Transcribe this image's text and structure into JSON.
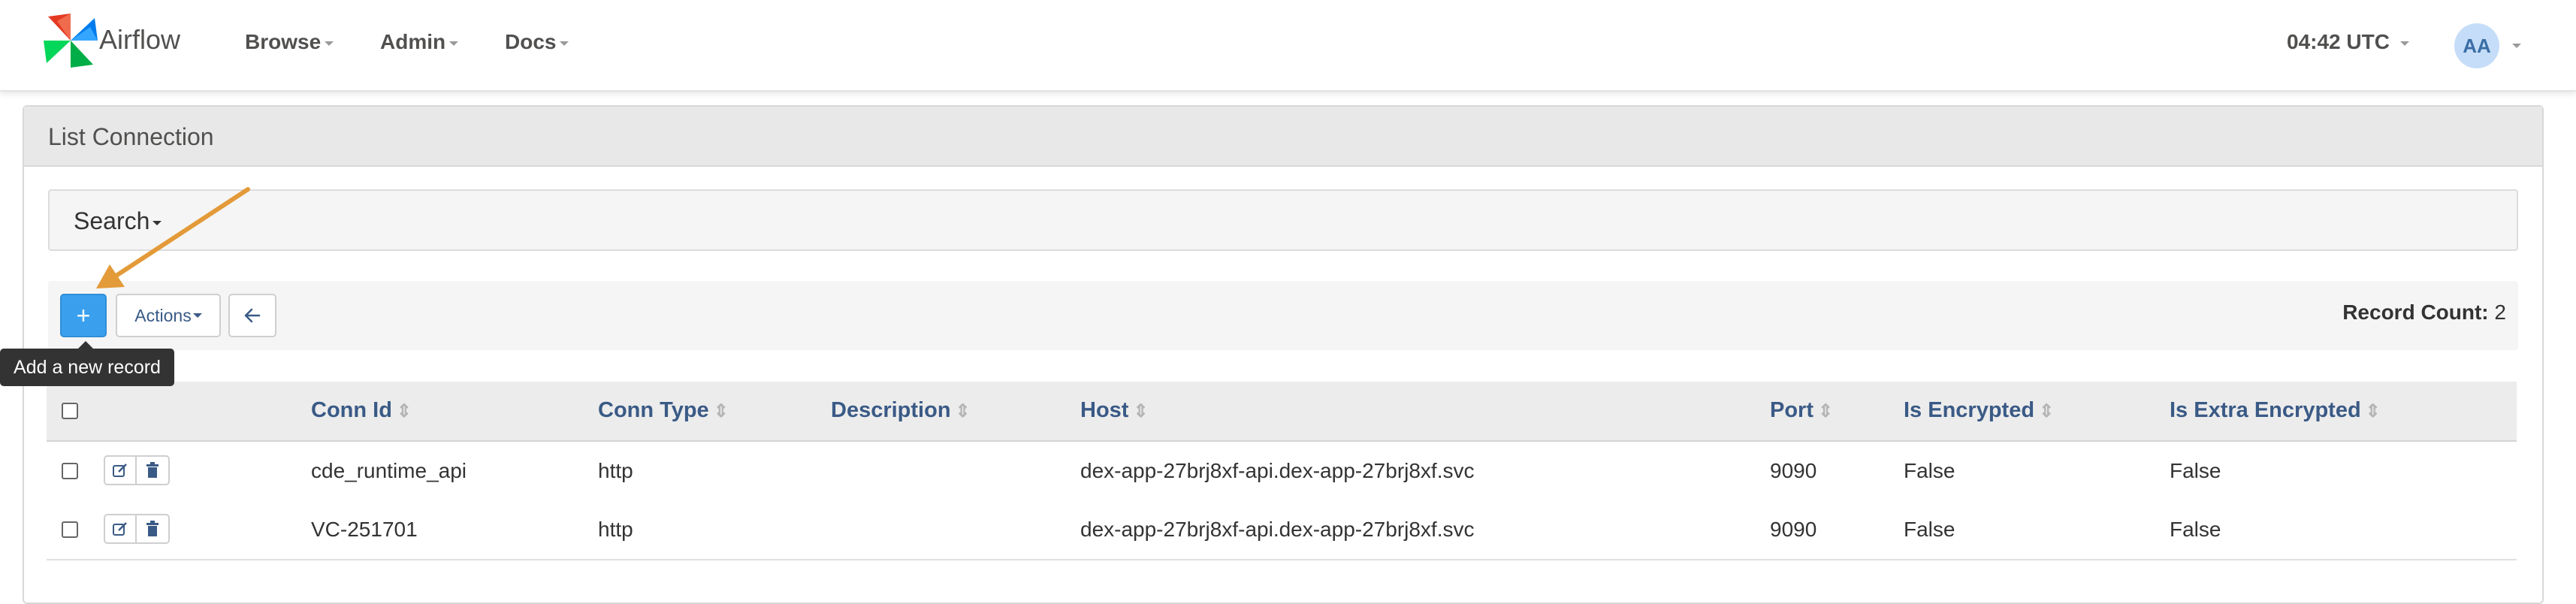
{
  "navbar": {
    "brand": "Airflow",
    "menu": [
      "Browse",
      "Admin",
      "Docs"
    ],
    "clock": "04:42 UTC",
    "user_initials": "AA"
  },
  "panel": {
    "title": "List Connection",
    "search_label": "Search"
  },
  "toolbar": {
    "add_symbol": "+",
    "actions_label": "Actions",
    "record_count_label": "Record Count:",
    "record_count_value": "2"
  },
  "tooltip": "Add a new record",
  "table": {
    "columns": [
      "Conn Id",
      "Conn Type",
      "Description",
      "Host",
      "Port",
      "Is Encrypted",
      "Is Extra Encrypted"
    ],
    "rows": [
      [
        "cde_runtime_api",
        "http",
        "",
        "dex-app-27brj8xf-api.dex-app-27brj8xf.svc",
        "9090",
        "False",
        "False"
      ],
      [
        "VC-251701",
        "http",
        "",
        "dex-app-27brj8xf-api.dex-app-27brj8xf.svc",
        "9090",
        "False",
        "False"
      ]
    ]
  },
  "colors": {
    "primary_button": "#3aa0ee",
    "link_text": "#3a5a86",
    "annotation_arrow": "#e39a38"
  },
  "icons": {
    "logo": "airflow-pinwheel-logo",
    "edit": "edit-icon",
    "delete": "trash-icon",
    "back": "arrow-left-icon"
  }
}
